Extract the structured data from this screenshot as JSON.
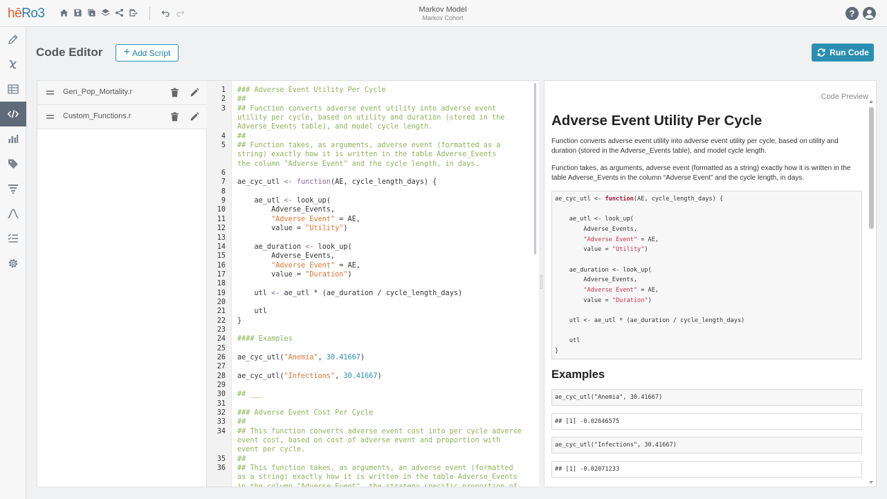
{
  "app": {
    "logo_part1": "hē",
    "logo_part2": "Ro3"
  },
  "header": {
    "title": "Markov Model",
    "subtitle": "Markov Cohort",
    "help": "?"
  },
  "page": {
    "title": "Code Editor",
    "add_script_label": "Add Script",
    "run_code_label": "Run Code"
  },
  "scripts": [
    {
      "name": "Gen_Pop_Mortality.r"
    },
    {
      "name": "Custom_Functions.r"
    }
  ],
  "editor": {
    "lines": [
      {
        "n": "1",
        "t": [
          [
            "c-com",
            "### Adverse Event Utility Per Cycle"
          ]
        ]
      },
      {
        "n": "2",
        "t": [
          [
            "c-com",
            "##"
          ]
        ]
      },
      {
        "n": "3",
        "t": [
          [
            "c-com",
            "## Function converts adverse event utility into adverse event"
          ]
        ]
      },
      {
        "n": "",
        "t": [
          [
            "c-com",
            "utility per cycle, based on utility and duration (stored in the"
          ]
        ]
      },
      {
        "n": "",
        "t": [
          [
            "c-com",
            "Adverse_Events table), and model cycle length."
          ]
        ]
      },
      {
        "n": "4",
        "t": [
          [
            "c-com",
            "##"
          ]
        ]
      },
      {
        "n": "5",
        "t": [
          [
            "c-com",
            "## Function takes, as arguments, adverse event (formatted as a"
          ]
        ]
      },
      {
        "n": "",
        "t": [
          [
            "c-com",
            "string) exactly how it is written in the table Adverse_Events"
          ]
        ]
      },
      {
        "n": "",
        "t": [
          [
            "c-com",
            "the column \"Adverse Event\" and the cycle length, in days."
          ]
        ]
      },
      {
        "n": "6",
        "t": []
      },
      {
        "n": "7",
        "t": [
          [
            "c-txt",
            "ae_cyc_utl "
          ],
          [
            "c-kw",
            "<-"
          ],
          [
            "c-txt",
            " "
          ],
          [
            "c-kw",
            "function"
          ],
          [
            "c-txt",
            "(AE, cycle_length_days) {"
          ]
        ]
      },
      {
        "n": "8",
        "t": []
      },
      {
        "n": "9",
        "t": [
          [
            "c-txt",
            "    ae_utl "
          ],
          [
            "c-kw",
            "<-"
          ],
          [
            "c-txt",
            " look_up("
          ]
        ]
      },
      {
        "n": "10",
        "t": [
          [
            "c-txt",
            "        Adverse_Events,"
          ]
        ]
      },
      {
        "n": "11",
        "t": [
          [
            "c-txt",
            "        "
          ],
          [
            "c-str",
            "\"Adverse Event\""
          ],
          [
            "c-txt",
            " = AE,"
          ]
        ]
      },
      {
        "n": "12",
        "t": [
          [
            "c-txt",
            "        value = "
          ],
          [
            "c-str",
            "\"Utility\""
          ],
          [
            "c-txt",
            ")"
          ]
        ]
      },
      {
        "n": "13",
        "t": []
      },
      {
        "n": "14",
        "t": [
          [
            "c-txt",
            "    ae_duration "
          ],
          [
            "c-kw",
            "<-"
          ],
          [
            "c-txt",
            " look_up("
          ]
        ]
      },
      {
        "n": "15",
        "t": [
          [
            "c-txt",
            "        Adverse_Events,"
          ]
        ]
      },
      {
        "n": "16",
        "t": [
          [
            "c-txt",
            "        "
          ],
          [
            "c-str",
            "\"Adverse Event\""
          ],
          [
            "c-txt",
            " = AE,"
          ]
        ]
      },
      {
        "n": "17",
        "t": [
          [
            "c-txt",
            "        value = "
          ],
          [
            "c-str",
            "\"Duration\""
          ],
          [
            "c-txt",
            ")"
          ]
        ]
      },
      {
        "n": "18",
        "t": []
      },
      {
        "n": "19",
        "t": [
          [
            "c-txt",
            "    utl "
          ],
          [
            "c-kw",
            "<-"
          ],
          [
            "c-txt",
            " ae_utl * (ae_duration / cycle_length_days)"
          ]
        ]
      },
      {
        "n": "20",
        "t": []
      },
      {
        "n": "21",
        "t": [
          [
            "c-txt",
            "    utl"
          ]
        ]
      },
      {
        "n": "22",
        "t": [
          [
            "c-txt",
            "}"
          ]
        ]
      },
      {
        "n": "23",
        "t": []
      },
      {
        "n": "24",
        "t": [
          [
            "c-com",
            "#### Examples"
          ]
        ]
      },
      {
        "n": "25",
        "t": []
      },
      {
        "n": "26",
        "t": [
          [
            "c-txt",
            "ae_cyc_utl("
          ],
          [
            "c-str",
            "\"Anemia\""
          ],
          [
            "c-txt",
            ", "
          ],
          [
            "c-num",
            "30.41667"
          ],
          [
            "c-txt",
            ")"
          ]
        ]
      },
      {
        "n": "27",
        "t": []
      },
      {
        "n": "28",
        "t": [
          [
            "c-txt",
            "ae_cyc_utl("
          ],
          [
            "c-str",
            "\"Infections\""
          ],
          [
            "c-txt",
            ", "
          ],
          [
            "c-num",
            "30.41667"
          ],
          [
            "c-txt",
            ")"
          ]
        ]
      },
      {
        "n": "29",
        "t": []
      },
      {
        "n": "30",
        "t": [
          [
            "c-com",
            "## ___"
          ]
        ]
      },
      {
        "n": "31",
        "t": []
      },
      {
        "n": "32",
        "t": [
          [
            "c-com",
            "### Adverse Event Cost Per Cycle"
          ]
        ]
      },
      {
        "n": "33",
        "t": [
          [
            "c-com",
            "##"
          ]
        ]
      },
      {
        "n": "34",
        "t": [
          [
            "c-com",
            "## This function converts adverse event cost into per cycle adverse"
          ]
        ]
      },
      {
        "n": "",
        "t": [
          [
            "c-com",
            "event cost, based on cost of adverse event and proportion with"
          ]
        ]
      },
      {
        "n": "",
        "t": [
          [
            "c-com",
            "event per cycle."
          ]
        ]
      },
      {
        "n": "35",
        "t": [
          [
            "c-com",
            "##"
          ]
        ]
      },
      {
        "n": "36",
        "t": [
          [
            "c-com",
            "## This function takes, as arguments, an adverse event (formatted"
          ]
        ]
      },
      {
        "n": "",
        "t": [
          [
            "c-com",
            "as a string) exactly how it is written in the table Adverse_Events"
          ]
        ]
      },
      {
        "n": "",
        "t": [
          [
            "c-com",
            "in the column \"Adverse Event\", the strategy specific proportion of"
          ]
        ]
      }
    ]
  },
  "preview": {
    "label": "Code Preview",
    "heading": "Adverse Event Utility Per Cycle",
    "para1": "Function converts adverse event utility into adverse event utility per cycle, based on utility and duration (stored in the Adverse_Events table), and model cycle length.",
    "para2": "Function takes, as arguments, adverse event (formatted as a string) exactly how it is written in the table Adverse_Events in the column “Adverse Event” and the cycle length, in days.",
    "code_lines": [
      [
        [
          "",
          "ae_cyc_utl <- "
        ],
        [
          "pv-kw",
          "function"
        ],
        [
          "",
          "(AE, cycle_length_days) {"
        ]
      ],
      [],
      [
        [
          "",
          "    ae_utl <- look_up("
        ]
      ],
      [
        [
          "",
          "        Adverse_Events,"
        ]
      ],
      [
        [
          "",
          "        "
        ],
        [
          "pv-str",
          "\"Adverse Event\""
        ],
        [
          "",
          " = AE,"
        ]
      ],
      [
        [
          "",
          "        value = "
        ],
        [
          "pv-str",
          "\"Utility\""
        ],
        [
          "",
          ")"
        ]
      ],
      [],
      [
        [
          "",
          "    ae_duration <- look_up("
        ]
      ],
      [
        [
          "",
          "        Adverse_Events,"
        ]
      ],
      [
        [
          "",
          "        "
        ],
        [
          "pv-str",
          "\"Adverse Event\""
        ],
        [
          "",
          " = AE,"
        ]
      ],
      [
        [
          "",
          "        value = "
        ],
        [
          "pv-str",
          "\"Duration\""
        ],
        [
          "",
          ")"
        ]
      ],
      [],
      [
        [
          "",
          "    utl <- ae_utl * (ae_duration / cycle_length_days)"
        ]
      ],
      [],
      [
        [
          "",
          "    utl"
        ]
      ],
      [
        [
          "",
          "}"
        ]
      ]
    ],
    "examples_heading": "Examples",
    "outputs": [
      {
        "style": "gray",
        "parts": [
          [
            "",
            "ae_cyc_utl("
          ],
          [
            "pv-str",
            "\"Anemia\""
          ],
          [
            "",
            ", "
          ],
          [
            "pv-num",
            "30.41667"
          ],
          [
            "",
            ")"
          ]
        ]
      },
      {
        "style": "",
        "parts": [
          [
            "",
            "## [1] -0.02646575"
          ]
        ]
      },
      {
        "style": "gray",
        "parts": [
          [
            "",
            "ae_cyc_utl("
          ],
          [
            "pv-str",
            "\"Infections\""
          ],
          [
            "",
            ", "
          ],
          [
            "pv-num",
            "30.41667"
          ],
          [
            "",
            ")"
          ]
        ]
      },
      {
        "style": "",
        "parts": [
          [
            "",
            "## [1] -0.02071233"
          ]
        ]
      }
    ]
  },
  "sidebar": {
    "items": [
      {
        "name": "pencil-icon"
      },
      {
        "name": "variable-icon"
      },
      {
        "name": "table-icon"
      },
      {
        "name": "code-icon",
        "active": true
      },
      {
        "name": "bar-chart-icon"
      },
      {
        "name": "tag-icon"
      },
      {
        "name": "filter-icon"
      },
      {
        "name": "curve-icon"
      },
      {
        "name": "checklist-icon"
      },
      {
        "name": "gear-icon"
      }
    ]
  },
  "colors": {
    "accent": "#2b8fb3",
    "sidebar_active": "#5f6b78",
    "comment": "#8db35a",
    "string": "#e0732f"
  }
}
